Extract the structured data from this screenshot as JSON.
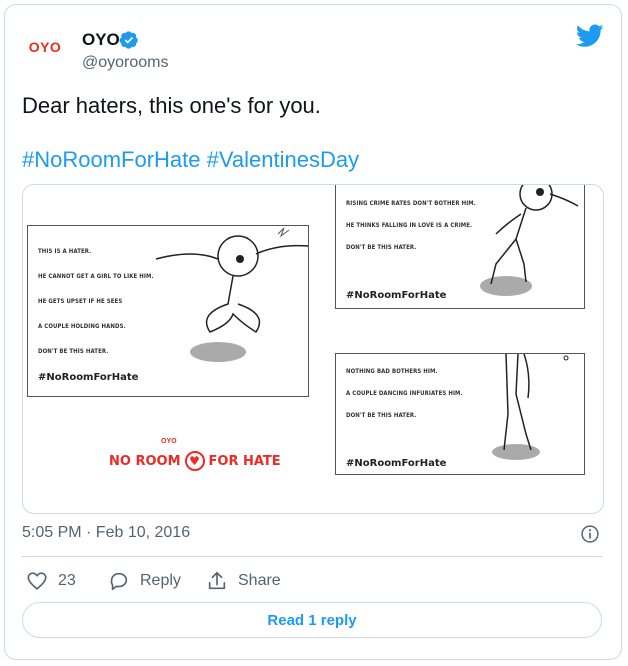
{
  "tweet": {
    "author_name": "OYO",
    "author_handle": "@oyorooms",
    "avatar_text": "OYO",
    "text": "Dear haters, this one's for you.",
    "hashtags": [
      "#NoRoomForHate",
      "#ValentinesDay"
    ],
    "timestamp": "5:05 PM · Feb 10, 2016",
    "likes_count": "23",
    "reply_label": "Reply",
    "share_label": "Share",
    "read_replies_label": "Read 1 reply"
  },
  "media": {
    "panel1": {
      "lines": [
        "THIS IS A HATER.",
        "HE CANNOT GET A GIRL TO LIKE HIM.",
        "HE GETS UPSET IF HE SEES",
        "A COUPLE HOLDING HANDS.",
        "DON'T BE THIS HATER."
      ],
      "tag": "#NoRoomForHate"
    },
    "panel2": {
      "lines": [
        "RISING CRIME RATES DON'T BOTHER HIM.",
        "HE THINKS FALLING IN LOVE IS A CRIME.",
        "DON'T BE THIS HATER."
      ],
      "tag": "#NoRoomForHate"
    },
    "panel3": {
      "lines": [
        "NOTHING BAD BOTHERS HIM.",
        "A COUPLE DANCING INFURIATES HIM.",
        "DON'T BE THIS HATER."
      ],
      "tag": "#NoRoomForHate"
    },
    "logo_small": "OYO",
    "logo_left": "NO ROOM",
    "logo_right": "FOR HATE"
  },
  "colors": {
    "accent": "#1d9bf0",
    "brand": "#ee2a24",
    "muted": "#536471",
    "border": "#cfd9de"
  }
}
